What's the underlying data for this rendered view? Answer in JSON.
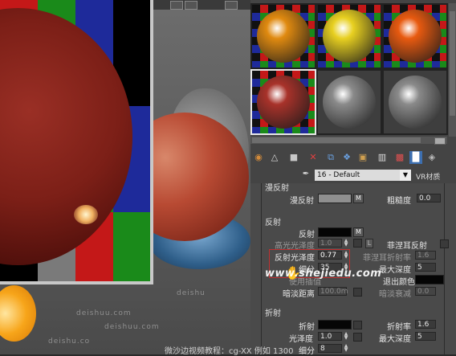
{
  "viewport": {
    "checker_colors": [
      "#c41818",
      "#1a8a1a",
      "#1e2a9a",
      "#000000",
      "#7a7a7a",
      "#c41818",
      "#1a8a1a",
      "#1e2a9a",
      "#000000",
      "#bdbdbd",
      "#c41818",
      "#1a8a1a",
      "#1e2a9a",
      "#000000",
      "#bdbdbd",
      "#7a7a7a"
    ],
    "floor_text": [
      "deishu",
      "deishuu.com",
      "deishuu.com",
      "deishu.co"
    ]
  },
  "material_editor": {
    "slots": [
      {
        "name": "orange-material",
        "color": "#e08a10"
      },
      {
        "name": "lemon-material",
        "color": "#e8d020"
      },
      {
        "name": "tangerine-material",
        "color": "#e85a10"
      },
      {
        "name": "apple-material",
        "color": "#a8322a",
        "active": true
      },
      {
        "name": "default-gray-1",
        "color": "#8a8a8a"
      },
      {
        "name": "default-gray-2",
        "color": "#8a8a8a"
      }
    ],
    "toolbar_icons": [
      "get-material-icon",
      "put-to-scene-icon",
      "assign-material-icon",
      "reset-icon",
      "copy-icon",
      "unique-icon",
      "put-library-icon",
      "material-effects-icon",
      "show-map-icon",
      "show-end-result-icon",
      "go-parent-icon"
    ],
    "material_name": "16 - Default",
    "material_type": "VR材质",
    "eyedropper_icon": "eyedropper-icon",
    "diffuse": {
      "section_label": "漫反射",
      "diffuse_label": "漫反射",
      "m_button": "M",
      "roughness_label": "粗糙度",
      "roughness_value": "0.0"
    },
    "reflection": {
      "section_label": "反射",
      "reflect_label": "反射",
      "m_button": "M",
      "hilight_gloss_label": "高光光泽度",
      "hilight_gloss_value": "1.0",
      "l_button": "L",
      "fresnel_label": "菲涅耳反射",
      "fresnel_ior_label": "菲涅耳折射率",
      "fresnel_ior_value": "1.6",
      "refl_gloss_label": "反射光泽度",
      "refl_gloss_value": "0.77",
      "subdivs_label": "细分",
      "subdivs_value": "35",
      "max_depth_label": "最大深度",
      "max_depth_value": "5",
      "interp_label": "使用插值",
      "exit_color_label": "退出颜色",
      "dim_distance_label": "暗淡距离",
      "dim_distance_value": "100.0m",
      "dim_falloff_label": "暗淡衰减",
      "dim_falloff_value": "0.0"
    },
    "refraction": {
      "section_label": "折射",
      "refract_label": "折射",
      "ior_label": "折射率",
      "ior_value": "1.6",
      "gloss_label": "光泽度",
      "gloss_value": "1.0",
      "max_depth_label": "最大深度",
      "max_depth_value": "5",
      "subdivs_label": "细分",
      "subdivs_value": "8"
    }
  },
  "watermark": "www.shejiedu.com",
  "bottom_text": "微沙边视频教程：cg-XX 例如 1300"
}
